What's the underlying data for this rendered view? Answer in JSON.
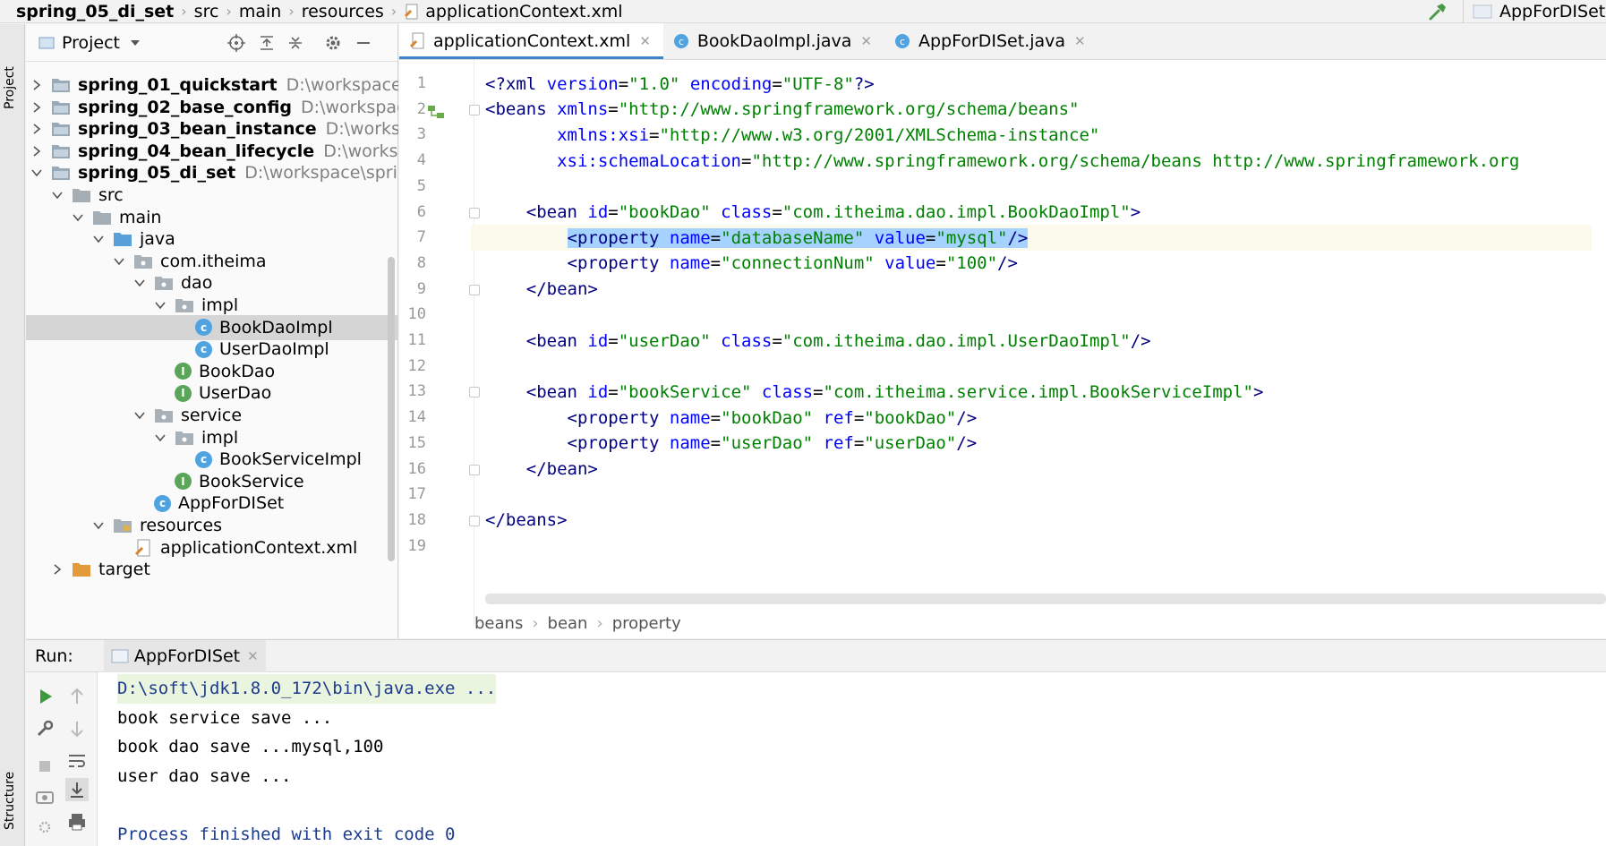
{
  "breadcrumb": [
    "spring_05_di_set",
    "src",
    "main",
    "resources",
    "applicationContext.xml"
  ],
  "run_config": "AppForDISet",
  "left_strip": {
    "project_label": "Project",
    "structure_label": "Structure"
  },
  "project_panel": {
    "title": "Project",
    "tree": [
      {
        "label": "spring_01_quickstart",
        "path": "D:\\workspace\\spri",
        "kind": "module",
        "indent": 0,
        "arrow": "right"
      },
      {
        "label": "spring_02_base_config",
        "path": "D:\\workspace\\sp",
        "kind": "module",
        "indent": 0,
        "arrow": "right"
      },
      {
        "label": "spring_03_bean_instance",
        "path": "D:\\workspace\\",
        "kind": "module",
        "indent": 0,
        "arrow": "right"
      },
      {
        "label": "spring_04_bean_lifecycle",
        "path": "D:\\workspace\\",
        "kind": "module",
        "indent": 0,
        "arrow": "right"
      },
      {
        "label": "spring_05_di_set",
        "path": "D:\\workspace\\spring\\s",
        "kind": "module",
        "indent": 0,
        "arrow": "down"
      },
      {
        "label": "src",
        "path": "",
        "kind": "folder",
        "indent": 1,
        "arrow": "down"
      },
      {
        "label": "main",
        "path": "",
        "kind": "folder",
        "indent": 2,
        "arrow": "down"
      },
      {
        "label": "java",
        "path": "",
        "kind": "folder-blue",
        "indent": 3,
        "arrow": "down"
      },
      {
        "label": "com.itheima",
        "path": "",
        "kind": "package",
        "indent": 4,
        "arrow": "down"
      },
      {
        "label": "dao",
        "path": "",
        "kind": "package",
        "indent": 5,
        "arrow": "down"
      },
      {
        "label": "impl",
        "path": "",
        "kind": "package",
        "indent": 6,
        "arrow": "down"
      },
      {
        "label": "BookDaoImpl",
        "path": "",
        "kind": "class",
        "indent": 7,
        "arrow": "",
        "selected": true
      },
      {
        "label": "UserDaoImpl",
        "path": "",
        "kind": "class",
        "indent": 7,
        "arrow": ""
      },
      {
        "label": "BookDao",
        "path": "",
        "kind": "interface",
        "indent": 6,
        "arrow": ""
      },
      {
        "label": "UserDao",
        "path": "",
        "kind": "interface",
        "indent": 6,
        "arrow": ""
      },
      {
        "label": "service",
        "path": "",
        "kind": "package",
        "indent": 5,
        "arrow": "down"
      },
      {
        "label": "impl",
        "path": "",
        "kind": "package",
        "indent": 6,
        "arrow": "down"
      },
      {
        "label": "BookServiceImpl",
        "path": "",
        "kind": "class",
        "indent": 7,
        "arrow": ""
      },
      {
        "label": "BookService",
        "path": "",
        "kind": "interface",
        "indent": 6,
        "arrow": ""
      },
      {
        "label": "AppForDISet",
        "path": "",
        "kind": "class-main",
        "indent": 5,
        "arrow": ""
      },
      {
        "label": "resources",
        "path": "",
        "kind": "folder-res",
        "indent": 3,
        "arrow": "down"
      },
      {
        "label": "applicationContext.xml",
        "path": "",
        "kind": "xml",
        "indent": 4,
        "arrow": ""
      },
      {
        "label": "target",
        "path": "",
        "kind": "folder-orange",
        "indent": 1,
        "arrow": "right"
      }
    ]
  },
  "editor": {
    "tabs": [
      {
        "label": "applicationContext.xml",
        "icon": "xml-file-icon",
        "active": true
      },
      {
        "label": "BookDaoImpl.java",
        "icon": "class-icon",
        "active": false
      },
      {
        "label": "AppForDISet.java",
        "icon": "class-icon",
        "active": false
      }
    ],
    "line_numbers": [
      "1",
      "2",
      "3",
      "4",
      "5",
      "6",
      "7",
      "8",
      "9",
      "10",
      "11",
      "12",
      "13",
      "14",
      "15",
      "16",
      "17",
      "18",
      "19"
    ],
    "lines": [
      [
        {
          "c": "t",
          "s": "<?xml "
        },
        {
          "c": "a",
          "s": "version"
        },
        {
          "c": "p",
          "s": "="
        },
        {
          "c": "v",
          "s": "\"1.0\" "
        },
        {
          "c": "a",
          "s": "encoding"
        },
        {
          "c": "p",
          "s": "="
        },
        {
          "c": "v",
          "s": "\"UTF-8\""
        },
        {
          "c": "t",
          "s": "?>"
        }
      ],
      [
        {
          "c": "t",
          "s": "<beans "
        },
        {
          "c": "a",
          "s": "xmlns"
        },
        {
          "c": "p",
          "s": "="
        },
        {
          "c": "v",
          "s": "\"http://www.springframework.org/schema/beans\""
        }
      ],
      [
        {
          "c": "p",
          "s": "       "
        },
        {
          "c": "a",
          "s": "xmlns:xsi"
        },
        {
          "c": "p",
          "s": "="
        },
        {
          "c": "v",
          "s": "\"http://www.w3.org/2001/XMLSchema-instance\""
        }
      ],
      [
        {
          "c": "p",
          "s": "       "
        },
        {
          "c": "a",
          "s": "xsi:schemaLocation"
        },
        {
          "c": "p",
          "s": "="
        },
        {
          "c": "v",
          "s": "\"http://www.springframework.org/schema/beans http://www.springframework.org"
        }
      ],
      [],
      [
        {
          "c": "t",
          "s": "    <bean "
        },
        {
          "c": "a",
          "s": "id"
        },
        {
          "c": "p",
          "s": "="
        },
        {
          "c": "v",
          "s": "\"bookDao\" "
        },
        {
          "c": "a",
          "s": "class"
        },
        {
          "c": "p",
          "s": "="
        },
        {
          "c": "v",
          "s": "\"com.itheima.dao.impl.BookDaoImpl\""
        },
        {
          "c": "t",
          "s": ">"
        }
      ],
      [
        {
          "c": "p",
          "s": "        "
        },
        {
          "c": "t",
          "s": "<property ",
          "sel": true
        },
        {
          "c": "a",
          "s": "name",
          "sel": true
        },
        {
          "c": "p",
          "s": "=",
          "sel": true
        },
        {
          "c": "v",
          "s": "\"databaseName\" ",
          "sel": true
        },
        {
          "c": "a",
          "s": "value",
          "sel": true
        },
        {
          "c": "p",
          "s": "=",
          "sel": true
        },
        {
          "c": "v",
          "s": "\"mysql\"",
          "sel": true
        },
        {
          "c": "t",
          "s": "/>",
          "sel": true
        }
      ],
      [
        {
          "c": "t",
          "s": "        <property "
        },
        {
          "c": "a",
          "s": "name"
        },
        {
          "c": "p",
          "s": "="
        },
        {
          "c": "v",
          "s": "\"connectionNum\" "
        },
        {
          "c": "a",
          "s": "value"
        },
        {
          "c": "p",
          "s": "="
        },
        {
          "c": "v",
          "s": "\"100\""
        },
        {
          "c": "t",
          "s": "/>"
        }
      ],
      [
        {
          "c": "t",
          "s": "    </bean>"
        }
      ],
      [],
      [
        {
          "c": "t",
          "s": "    <bean "
        },
        {
          "c": "a",
          "s": "id"
        },
        {
          "c": "p",
          "s": "="
        },
        {
          "c": "v",
          "s": "\"userDao\" "
        },
        {
          "c": "a",
          "s": "class"
        },
        {
          "c": "p",
          "s": "="
        },
        {
          "c": "v",
          "s": "\"com.itheima.dao.impl.UserDaoImpl\""
        },
        {
          "c": "t",
          "s": "/>"
        }
      ],
      [],
      [
        {
          "c": "t",
          "s": "    <bean "
        },
        {
          "c": "a",
          "s": "id"
        },
        {
          "c": "p",
          "s": "="
        },
        {
          "c": "v",
          "s": "\"bookService\" "
        },
        {
          "c": "a",
          "s": "class"
        },
        {
          "c": "p",
          "s": "="
        },
        {
          "c": "v",
          "s": "\"com.itheima.service.impl.BookServiceImpl\""
        },
        {
          "c": "t",
          "s": ">"
        }
      ],
      [
        {
          "c": "t",
          "s": "        <property "
        },
        {
          "c": "a",
          "s": "name"
        },
        {
          "c": "p",
          "s": "="
        },
        {
          "c": "v",
          "s": "\"bookDao\" "
        },
        {
          "c": "a",
          "s": "ref"
        },
        {
          "c": "p",
          "s": "="
        },
        {
          "c": "v",
          "s": "\"bookDao\""
        },
        {
          "c": "t",
          "s": "/>"
        }
      ],
      [
        {
          "c": "t",
          "s": "        <property "
        },
        {
          "c": "a",
          "s": "name"
        },
        {
          "c": "p",
          "s": "="
        },
        {
          "c": "v",
          "s": "\"userDao\" "
        },
        {
          "c": "a",
          "s": "ref"
        },
        {
          "c": "p",
          "s": "="
        },
        {
          "c": "v",
          "s": "\"userDao\""
        },
        {
          "c": "t",
          "s": "/>"
        }
      ],
      [
        {
          "c": "t",
          "s": "    </bean>"
        }
      ],
      [],
      [
        {
          "c": "t",
          "s": "</beans>"
        }
      ],
      []
    ],
    "footer_crumbs": [
      "beans",
      "bean",
      "property"
    ]
  },
  "run_panel": {
    "label": "Run:",
    "tab": "AppForDISet",
    "console": [
      {
        "text": "D:\\soft\\jdk1.8.0_172\\bin\\java.exe ...",
        "kind": "cmd"
      },
      {
        "text": "book service save ...",
        "kind": "out"
      },
      {
        "text": "book dao save ...mysql,100",
        "kind": "out"
      },
      {
        "text": "user dao save ...",
        "kind": "out"
      },
      {
        "text": "",
        "kind": "out"
      },
      {
        "text": "Process finished with exit code 0",
        "kind": "exit"
      }
    ]
  },
  "colors": {
    "accent": "#4083c9",
    "selection": "#a6d2ff",
    "tag": "#000080",
    "attr": "#0000ff",
    "string": "#008000"
  }
}
